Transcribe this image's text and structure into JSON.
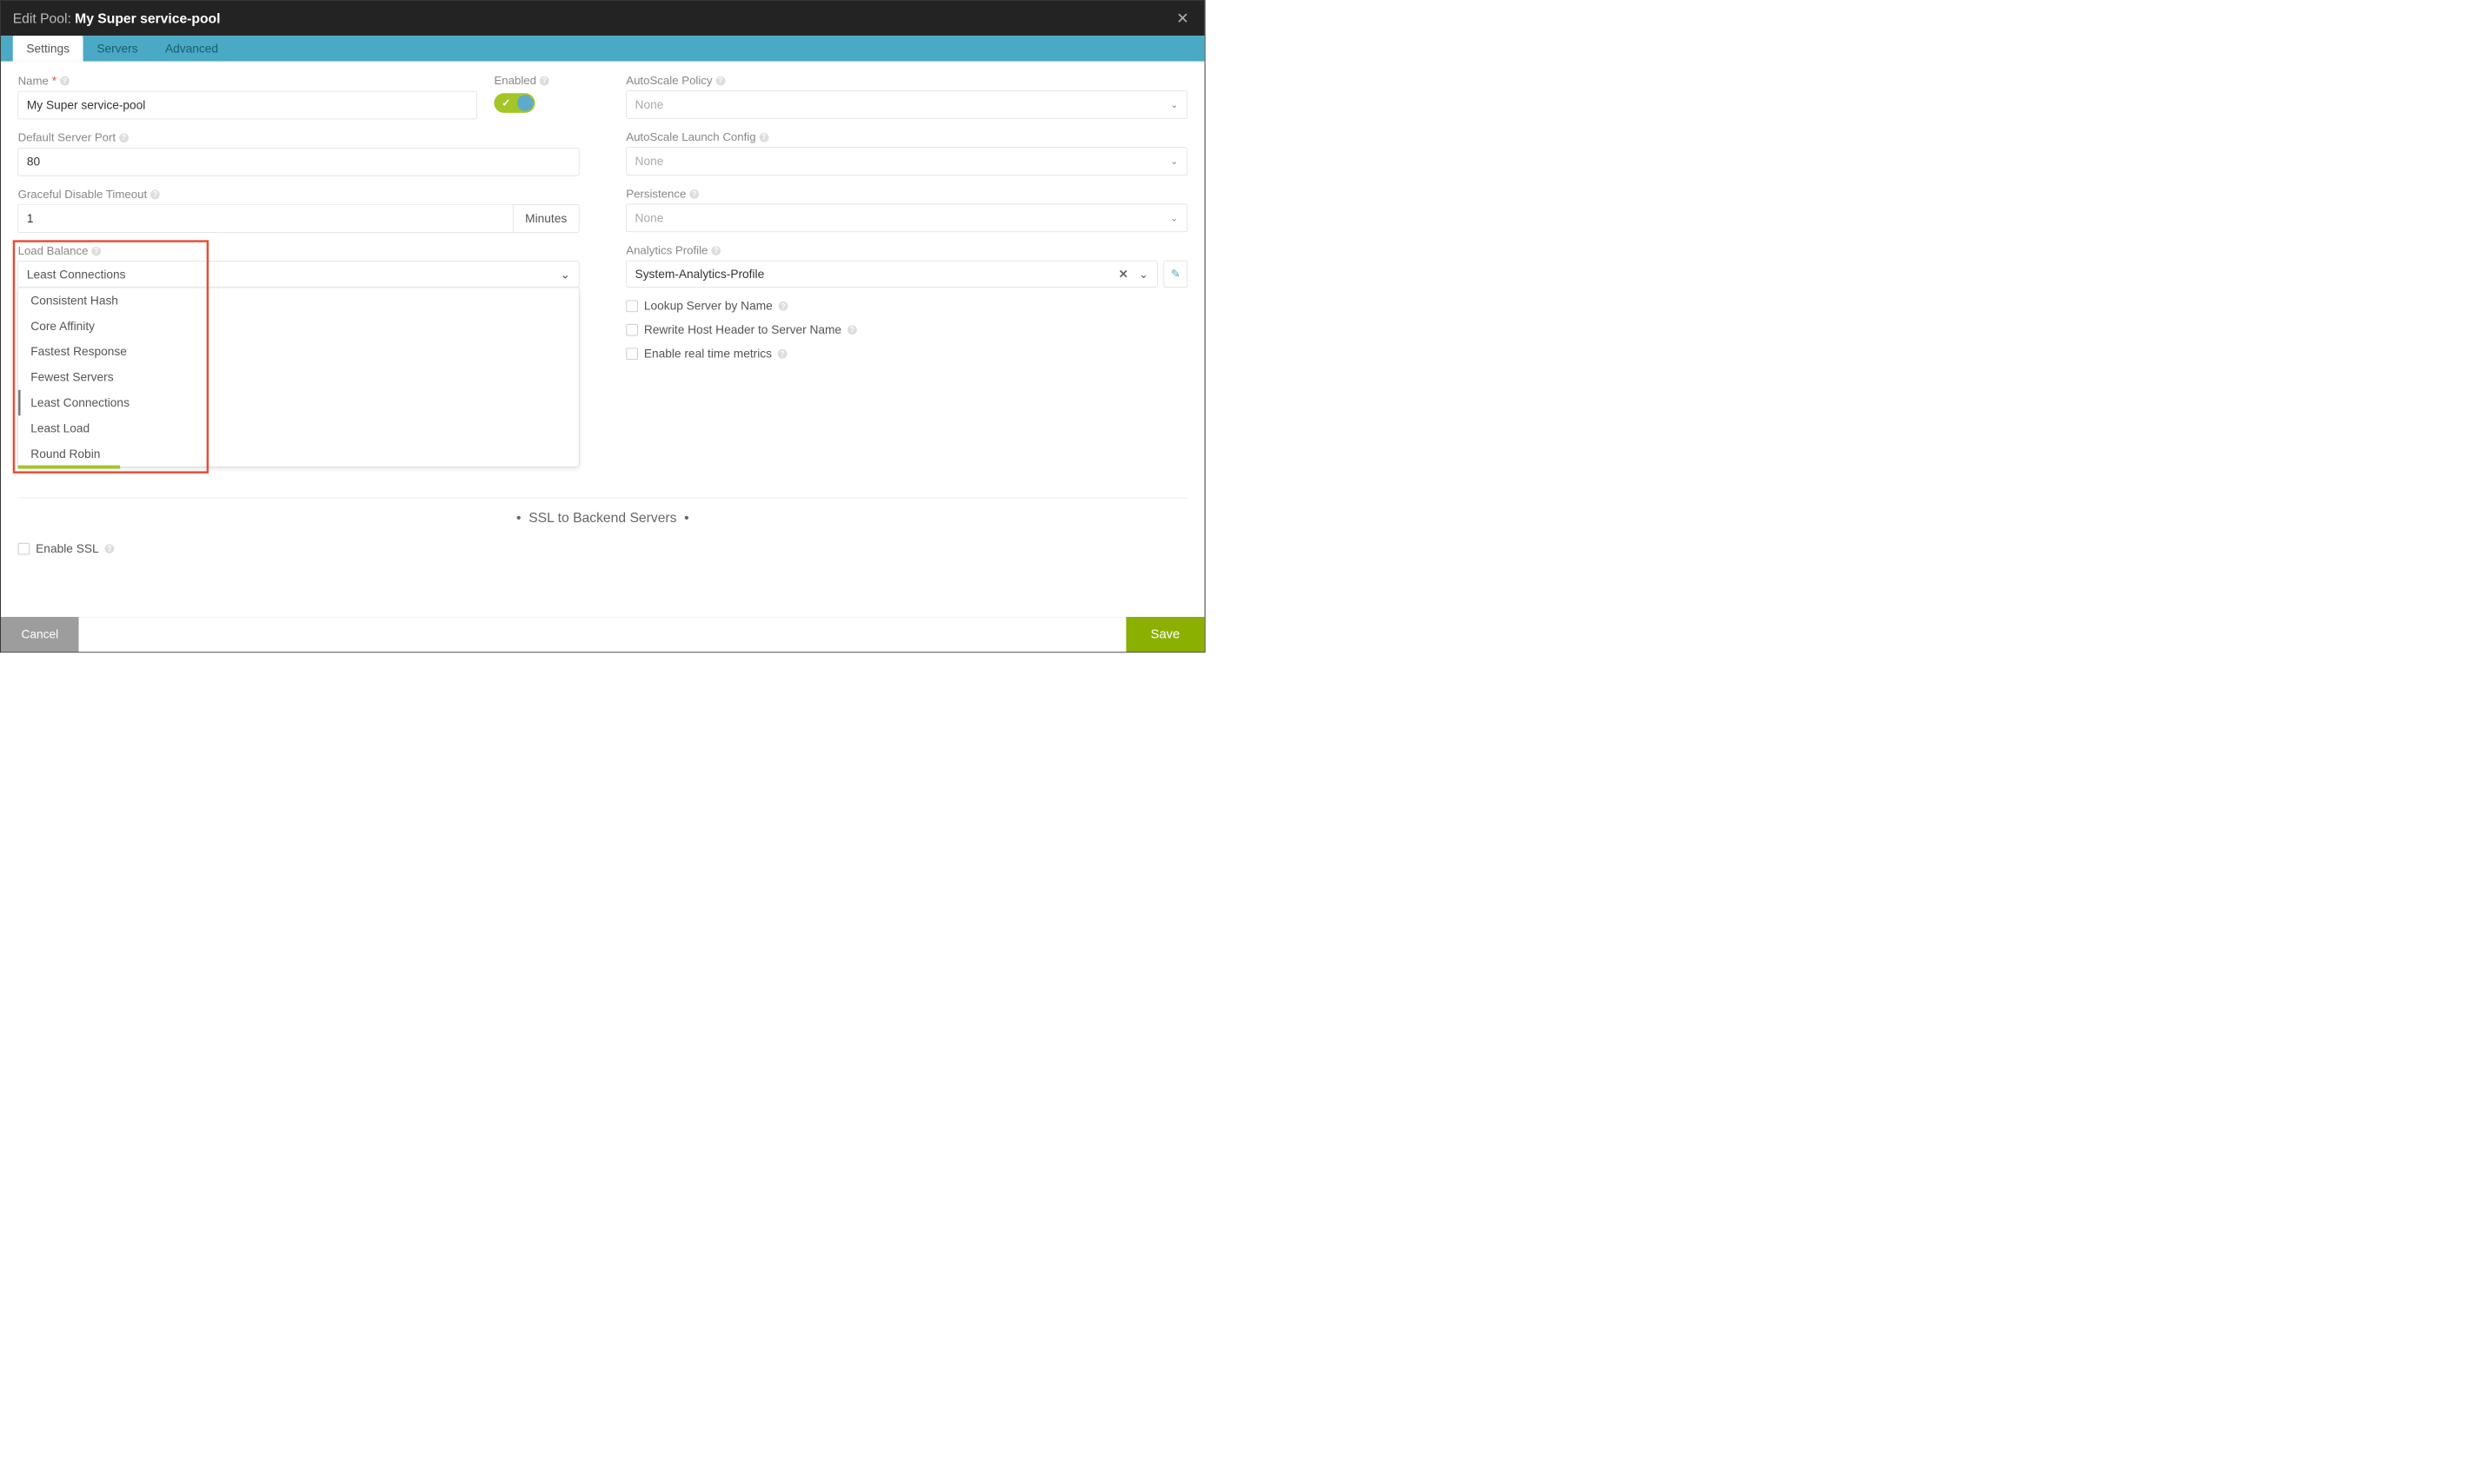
{
  "titlebar": {
    "prefix": "Edit Pool:",
    "name": "My Super service-pool"
  },
  "tabs": [
    "Settings",
    "Servers",
    "Advanced"
  ],
  "active_tab": 0,
  "left": {
    "name": {
      "label": "Name",
      "value": "My Super service-pool"
    },
    "enabled": {
      "label": "Enabled"
    },
    "default_port": {
      "label": "Default Server Port",
      "value": "80"
    },
    "graceful": {
      "label": "Graceful Disable Timeout",
      "value": "1",
      "unit": "Minutes"
    },
    "load_balance": {
      "label": "Load Balance",
      "selected": "Least Connections",
      "options": [
        "Consistent Hash",
        "Core Affinity",
        "Fastest Response",
        "Fewest Servers",
        "Least Connections",
        "Least Load",
        "Round Robin"
      ],
      "selected_index": 4
    }
  },
  "right": {
    "autoscale_policy": {
      "label": "AutoScale Policy",
      "placeholder": "None"
    },
    "autoscale_launch": {
      "label": "AutoScale Launch Config",
      "placeholder": "None"
    },
    "persistence": {
      "label": "Persistence",
      "placeholder": "None"
    },
    "analytics": {
      "label": "Analytics Profile",
      "value": "System-Analytics-Profile"
    },
    "checkboxes": [
      "Lookup Server by Name",
      "Rewrite Host Header to Server Name",
      "Enable real time metrics"
    ]
  },
  "ssl": {
    "heading": "SSL to Backend Servers",
    "enable_label": "Enable SSL"
  },
  "footer": {
    "cancel": "Cancel",
    "save": "Save"
  }
}
